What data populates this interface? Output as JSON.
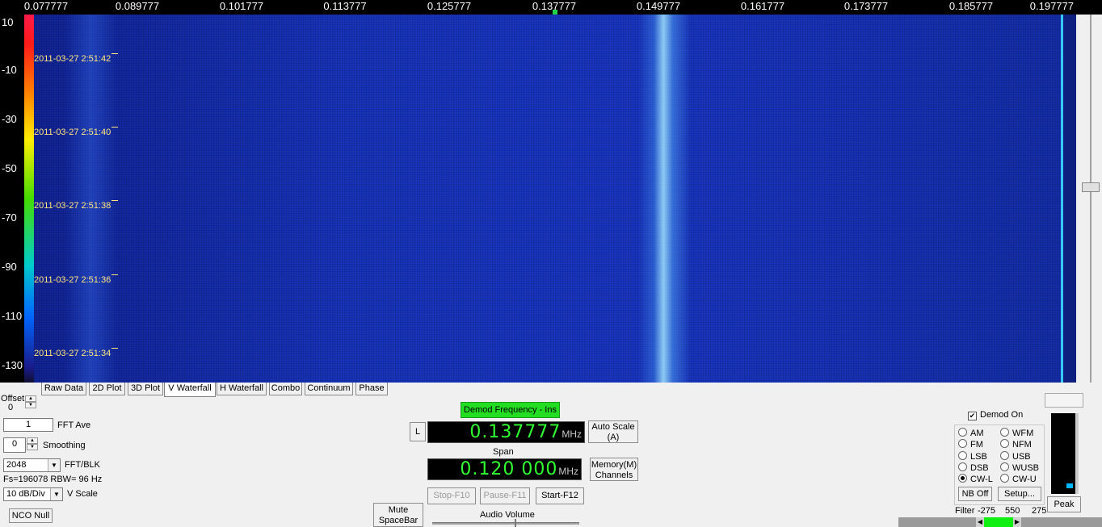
{
  "freq_axis": {
    "ticks": [
      "0.077777",
      "0.089777",
      "0.101777",
      "0.113777",
      "0.125777",
      "0.137777",
      "0.149777",
      "0.161777",
      "0.173777",
      "0.185777",
      "0.197777"
    ]
  },
  "db_axis": {
    "labels": [
      "10",
      "-10",
      "-30",
      "-50",
      "-70",
      "-90",
      "-110",
      "-130"
    ]
  },
  "timestamps": [
    "2011-03-27 2:51:42",
    "2011-03-27 2:51:40",
    "2011-03-27 2:51:38",
    "2011-03-27 2:51:36",
    "2011-03-27 2:51:34"
  ],
  "tabs": [
    "Raw Data",
    "2D Plot",
    "3D Plot",
    "V Waterfall",
    "H Waterfall",
    "Combo",
    "Continuum",
    "Phase"
  ],
  "active_tab": "V Waterfall",
  "left_controls": {
    "offset_label": "Offset",
    "offset_value": "0",
    "fft_ave_value": "1",
    "fft_ave_label": "FFT Ave",
    "smoothing_value": "0",
    "smoothing_label": "Smoothing",
    "fft_blk_value": "2048",
    "fft_blk_label": "FFT/BLK",
    "fs_text": "Fs=196078 RBW=  96 Hz",
    "vscale_value": "10 dB/Div",
    "vscale_label": "V Scale",
    "nco_null": "NCO Null"
  },
  "center": {
    "demod_freq_button": "Demod Frequency - Ins",
    "l_button": "L",
    "freq_value": "0.137777",
    "freq_unit": "MHz",
    "auto_scale_line1": "Auto Scale",
    "auto_scale_line2": "(A)",
    "span_label": "Span",
    "span_value": "0.120 000",
    "span_unit": "MHz",
    "memory_line1": "Memory(M)",
    "memory_line2": "Channels",
    "stop": "Stop-F10",
    "pause": "Pause-F11",
    "start": "Start-F12",
    "mute_line1": "Mute",
    "mute_line2": "SpaceBar",
    "audio_volume": "Audio Volume"
  },
  "right": {
    "demod_on": "Demod On",
    "modes_left": [
      "AM",
      "FM",
      "LSB",
      "DSB",
      "CW-L"
    ],
    "modes_right": [
      "WFM",
      "NFM",
      "USB",
      "WUSB",
      "CW-U"
    ],
    "selected_mode": "CW-L",
    "nb_off": "NB Off",
    "setup": "Setup...",
    "filter_label": "Filter",
    "filter_values": [
      "-275",
      "550",
      "275"
    ],
    "peak": "Peak",
    "meter_level": 0.06
  },
  "colors": {
    "lcd_text": "#32ff32",
    "demod_button": "#22dd22",
    "timestamp": "#ffe680",
    "waterfall_base": "#1838c8"
  }
}
